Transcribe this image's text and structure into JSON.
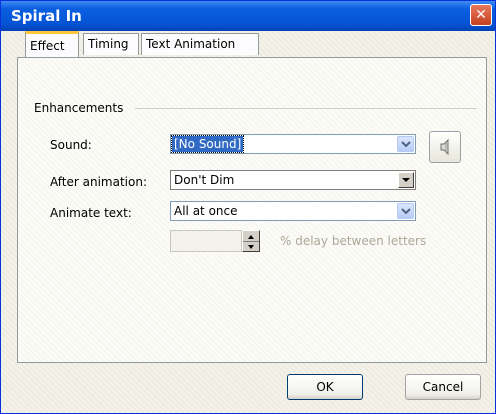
{
  "window": {
    "title": "Spiral In",
    "close_glyph": "✕"
  },
  "tabs": [
    {
      "label": "Effect",
      "active": true
    },
    {
      "label": "Timing",
      "active": false
    },
    {
      "label": "Text Animation",
      "active": false
    }
  ],
  "group": {
    "label": "Enhancements"
  },
  "sound": {
    "label": "Sound:",
    "value": "[No Sound]"
  },
  "after_animation": {
    "label": "After animation:",
    "value": "Don't Dim"
  },
  "animate_text": {
    "label": "Animate text:",
    "value": "All at once"
  },
  "delay": {
    "value": "",
    "label": "% delay between letters",
    "enabled": false
  },
  "buttons": {
    "ok": "OK",
    "cancel": "Cancel"
  },
  "colors": {
    "titlebar": "#0554d6",
    "selection": "#316ac5",
    "disabled_text": "#aca899"
  },
  "icons": {
    "sound_button": "speaker-icon",
    "dropdown": "chevron-down-icon"
  }
}
